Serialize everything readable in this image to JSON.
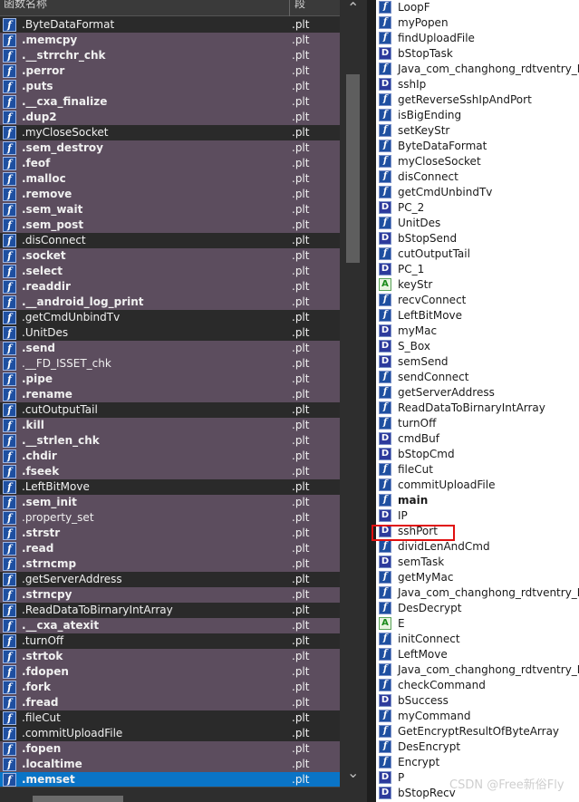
{
  "left_pane": {
    "header": {
      "name_col": "函数名称",
      "segment_col": "段"
    },
    "functions": [
      {
        "name": ".ByteDataFormat",
        "segment": ".plt",
        "style": "dark",
        "bold": false
      },
      {
        "name": ".memcpy",
        "segment": ".plt",
        "style": "purple",
        "bold": true
      },
      {
        "name": ".__strrchr_chk",
        "segment": ".plt",
        "style": "purple",
        "bold": true
      },
      {
        "name": ".perror",
        "segment": ".plt",
        "style": "purple",
        "bold": true
      },
      {
        "name": ".puts",
        "segment": ".plt",
        "style": "purple",
        "bold": true
      },
      {
        "name": ".__cxa_finalize",
        "segment": ".plt",
        "style": "purple",
        "bold": true
      },
      {
        "name": ".dup2",
        "segment": ".plt",
        "style": "purple",
        "bold": true
      },
      {
        "name": ".myCloseSocket",
        "segment": ".plt",
        "style": "dark",
        "bold": false
      },
      {
        "name": ".sem_destroy",
        "segment": ".plt",
        "style": "purple",
        "bold": true
      },
      {
        "name": ".feof",
        "segment": ".plt",
        "style": "purple",
        "bold": true
      },
      {
        "name": ".malloc",
        "segment": ".plt",
        "style": "purple",
        "bold": true
      },
      {
        "name": ".remove",
        "segment": ".plt",
        "style": "purple",
        "bold": true
      },
      {
        "name": ".sem_wait",
        "segment": ".plt",
        "style": "purple",
        "bold": true
      },
      {
        "name": ".sem_post",
        "segment": ".plt",
        "style": "purple",
        "bold": true
      },
      {
        "name": ".disConnect",
        "segment": ".plt",
        "style": "dark",
        "bold": false
      },
      {
        "name": ".socket",
        "segment": ".plt",
        "style": "purple",
        "bold": true
      },
      {
        "name": ".select",
        "segment": ".plt",
        "style": "purple",
        "bold": true
      },
      {
        "name": ".readdir",
        "segment": ".plt",
        "style": "purple",
        "bold": true
      },
      {
        "name": ".__android_log_print",
        "segment": ".plt",
        "style": "purple",
        "bold": true
      },
      {
        "name": ".getCmdUnbindTv",
        "segment": ".plt",
        "style": "dark",
        "bold": false
      },
      {
        "name": ".UnitDes",
        "segment": ".plt",
        "style": "dark",
        "bold": false
      },
      {
        "name": ".send",
        "segment": ".plt",
        "style": "purple",
        "bold": true
      },
      {
        "name": ".__FD_ISSET_chk",
        "segment": ".plt",
        "style": "purple",
        "bold": false
      },
      {
        "name": ".pipe",
        "segment": ".plt",
        "style": "purple",
        "bold": true
      },
      {
        "name": ".rename",
        "segment": ".plt",
        "style": "purple",
        "bold": true
      },
      {
        "name": ".cutOutputTail",
        "segment": ".plt",
        "style": "dark",
        "bold": false
      },
      {
        "name": ".kill",
        "segment": ".plt",
        "style": "purple",
        "bold": true
      },
      {
        "name": ".__strlen_chk",
        "segment": ".plt",
        "style": "purple",
        "bold": true
      },
      {
        "name": ".chdir",
        "segment": ".plt",
        "style": "purple",
        "bold": true
      },
      {
        "name": ".fseek",
        "segment": ".plt",
        "style": "purple",
        "bold": true
      },
      {
        "name": ".LeftBitMove",
        "segment": ".plt",
        "style": "dark",
        "bold": false
      },
      {
        "name": ".sem_init",
        "segment": ".plt",
        "style": "purple",
        "bold": true
      },
      {
        "name": ".property_set",
        "segment": ".plt",
        "style": "purple",
        "bold": false
      },
      {
        "name": ".strstr",
        "segment": ".plt",
        "style": "purple",
        "bold": true
      },
      {
        "name": ".read",
        "segment": ".plt",
        "style": "purple",
        "bold": true
      },
      {
        "name": ".strncmp",
        "segment": ".plt",
        "style": "purple",
        "bold": true
      },
      {
        "name": ".getServerAddress",
        "segment": ".plt",
        "style": "dark",
        "bold": false
      },
      {
        "name": ".strncpy",
        "segment": ".plt",
        "style": "purple",
        "bold": true
      },
      {
        "name": ".ReadDataToBirnaryIntArray",
        "segment": ".plt",
        "style": "dark",
        "bold": false
      },
      {
        "name": ".__cxa_atexit",
        "segment": ".plt",
        "style": "purple",
        "bold": true
      },
      {
        "name": ".turnOff",
        "segment": ".plt",
        "style": "dark",
        "bold": false
      },
      {
        "name": ".strtok",
        "segment": ".plt",
        "style": "purple",
        "bold": true
      },
      {
        "name": ".fdopen",
        "segment": ".plt",
        "style": "purple",
        "bold": true
      },
      {
        "name": ".fork",
        "segment": ".plt",
        "style": "purple",
        "bold": true
      },
      {
        "name": ".fread",
        "segment": ".plt",
        "style": "purple",
        "bold": true
      },
      {
        "name": ".fileCut",
        "segment": ".plt",
        "style": "dark",
        "bold": false
      },
      {
        "name": ".commitUploadFile",
        "segment": ".plt",
        "style": "dark",
        "bold": false
      },
      {
        "name": ".fopen",
        "segment": ".plt",
        "style": "purple",
        "bold": true
      },
      {
        "name": ".localtime",
        "segment": ".plt",
        "style": "purple",
        "bold": true
      },
      {
        "name": ".memset",
        "segment": ".plt",
        "style": "selected",
        "bold": true
      }
    ]
  },
  "right_pane": {
    "names": [
      {
        "icon": "f",
        "name": "LoopF",
        "bold": false
      },
      {
        "icon": "f",
        "name": "myPopen",
        "bold": false
      },
      {
        "icon": "f",
        "name": "findUploadFile",
        "bold": false
      },
      {
        "icon": "D",
        "name": "bStopTask",
        "bold": false
      },
      {
        "icon": "f",
        "name": "Java_com_changhong_rdtventry_RDeb",
        "bold": false
      },
      {
        "icon": "D",
        "name": "sshIp",
        "bold": false
      },
      {
        "icon": "f",
        "name": "getReverseSshIpAndPort",
        "bold": false
      },
      {
        "icon": "f",
        "name": "isBigEnding",
        "bold": false
      },
      {
        "icon": "f",
        "name": "setKeyStr",
        "bold": false
      },
      {
        "icon": "f",
        "name": "ByteDataFormat",
        "bold": false
      },
      {
        "icon": "f",
        "name": "myCloseSocket",
        "bold": false
      },
      {
        "icon": "f",
        "name": "disConnect",
        "bold": false
      },
      {
        "icon": "f",
        "name": "getCmdUnbindTv",
        "bold": false
      },
      {
        "icon": "D",
        "name": "PC_2",
        "bold": false
      },
      {
        "icon": "f",
        "name": "UnitDes",
        "bold": false
      },
      {
        "icon": "D",
        "name": "bStopSend",
        "bold": false
      },
      {
        "icon": "f",
        "name": "cutOutputTail",
        "bold": false
      },
      {
        "icon": "D",
        "name": "PC_1",
        "bold": false
      },
      {
        "icon": "A",
        "name": "keyStr",
        "bold": false
      },
      {
        "icon": "f",
        "name": "recvConnect",
        "bold": false
      },
      {
        "icon": "f",
        "name": "LeftBitMove",
        "bold": false
      },
      {
        "icon": "D",
        "name": "myMac",
        "bold": false
      },
      {
        "icon": "D",
        "name": "S_Box",
        "bold": false
      },
      {
        "icon": "D",
        "name": "semSend",
        "bold": false
      },
      {
        "icon": "f",
        "name": "sendConnect",
        "bold": false
      },
      {
        "icon": "f",
        "name": "getServerAddress",
        "bold": false
      },
      {
        "icon": "f",
        "name": "ReadDataToBirnaryIntArray",
        "bold": false
      },
      {
        "icon": "f",
        "name": "turnOff",
        "bold": false
      },
      {
        "icon": "D",
        "name": "cmdBuf",
        "bold": false
      },
      {
        "icon": "D",
        "name": "bStopCmd",
        "bold": false
      },
      {
        "icon": "f",
        "name": "fileCut",
        "bold": false
      },
      {
        "icon": "f",
        "name": "commitUploadFile",
        "bold": false
      },
      {
        "icon": "f",
        "name": "main",
        "bold": true
      },
      {
        "icon": "D",
        "name": "IP",
        "bold": false
      },
      {
        "icon": "D",
        "name": "sshPort",
        "bold": false
      },
      {
        "icon": "f",
        "name": "dividLenAndCmd",
        "bold": false
      },
      {
        "icon": "D",
        "name": "semTask",
        "bold": false
      },
      {
        "icon": "f",
        "name": "getMyMac",
        "bold": false
      },
      {
        "icon": "f",
        "name": "Java_com_changhong_rdtventry_RDeb",
        "bold": false
      },
      {
        "icon": "f",
        "name": "DesDecrypt",
        "bold": false
      },
      {
        "icon": "A",
        "name": "E",
        "bold": false
      },
      {
        "icon": "f",
        "name": "initConnect",
        "bold": false
      },
      {
        "icon": "f",
        "name": "LeftMove",
        "bold": false
      },
      {
        "icon": "f",
        "name": "Java_com_changhong_rdtventry_RDeb",
        "bold": false
      },
      {
        "icon": "f",
        "name": "checkCommand",
        "bold": false
      },
      {
        "icon": "D",
        "name": "bSuccess",
        "bold": false
      },
      {
        "icon": "f",
        "name": "myCommand",
        "bold": false
      },
      {
        "icon": "f",
        "name": "GetEncryptResultOfByteArray",
        "bold": false
      },
      {
        "icon": "f",
        "name": "DesEncrypt",
        "bold": false
      },
      {
        "icon": "f",
        "name": "Encrypt",
        "bold": false
      },
      {
        "icon": "D",
        "name": "P",
        "bold": false
      },
      {
        "icon": "D",
        "name": "bStopRecv",
        "bold": false
      }
    ],
    "highlighted": "sshPort"
  },
  "watermark": "CSDN @Free新俗Fly",
  "colors": {
    "purple_row": "#5c4d5e",
    "dark_row": "#2a2a2a",
    "selected_row": "#0a74c6",
    "highlight_box": "#e01010"
  }
}
